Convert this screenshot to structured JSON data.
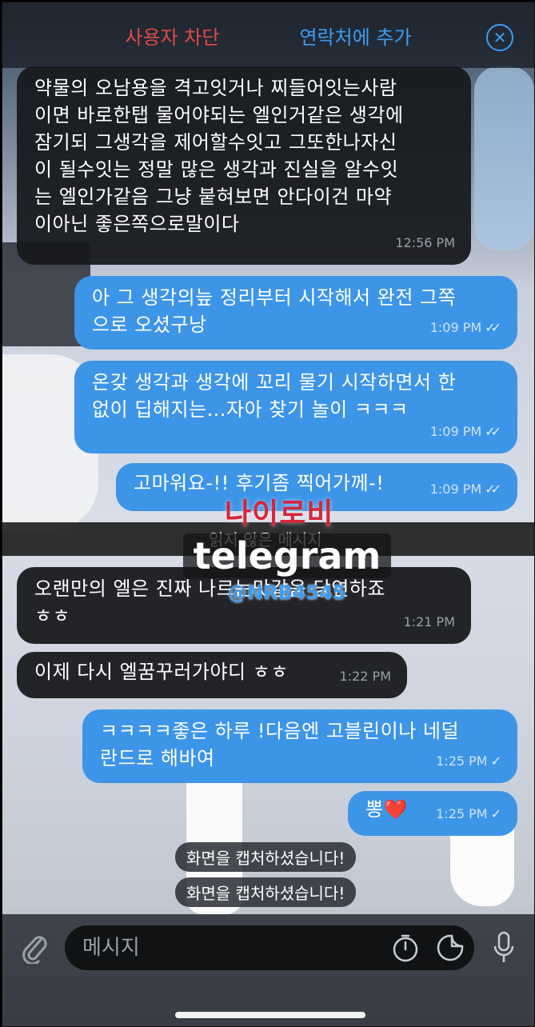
{
  "header": {
    "block_user": "사용자 차단",
    "add_contact": "연락처에 추가",
    "close_icon": "close-circle-icon"
  },
  "messages": [
    {
      "dir": "in",
      "text": "약물의 오남용을 격고잇거나 찌들어잇는사람\n이면 바로한탭 물어야되는 엘인거같은 생각에\n잠기되 그생각을 제어할수잇고 그또한나자신\n이 될수잇는 정말 많은 생각과 진실을 알수잇\n는 엘인가같음 그냥 붙혀보면 안다이건 마약\n이아닌 좋은쪽으로말이다",
      "time": "12:56 PM"
    },
    {
      "dir": "out",
      "text": "아 그 생각의늪 정리부터 시작해서 완전 그쪽\n으로 오셨구낭",
      "time": "1:09 PM",
      "status": "read"
    },
    {
      "dir": "out",
      "text": "온갖 생각과 생각에 꼬리 물기 시작하면서 한\n없이 딥해지는...자아 찾기 놀이 ㅋㅋㅋ",
      "time": "1:09 PM",
      "status": "read"
    },
    {
      "dir": "out",
      "text": "고마워요-!! 후기좀 찍어가께-!",
      "time": "1:09 PM",
      "status": "read"
    },
    {
      "dir": "in",
      "text": "오랜만의 엘은 진짜 나르는맛같음 당연하죠\nㅎㅎ",
      "time": "1:21 PM"
    },
    {
      "dir": "in",
      "text": "이제 다시 엘꿈꾸러가야디 ㅎㅎ",
      "time": "1:22 PM"
    },
    {
      "dir": "out",
      "text": "ㅋㅋㅋㅋ좋은 하루 !다음엔 고블린이나 네덜\n란드로 해바여",
      "time": "1:25 PM",
      "status": "delivered"
    },
    {
      "dir": "out",
      "text": "뽕❤️",
      "time": "1:25 PM",
      "status": "delivered"
    }
  ],
  "unread_divider": "읽지 않은 메시지",
  "system_notices": [
    "화면을 캡처하셨습니다!",
    "화면을 캡처하셨습니다!"
  ],
  "watermark": {
    "korean": "나이로비",
    "brand": "telegram",
    "handle": "@NRB4545"
  },
  "composer": {
    "placeholder": "메시지",
    "icons": [
      "paperclip-icon",
      "timer-icon",
      "sticker-icon",
      "microphone-icon"
    ]
  },
  "colors": {
    "accent": "#3d9cf2",
    "danger": "#e24a45",
    "outgoing_bubble": "#3d95e8",
    "incoming_bubble": "#16181c"
  }
}
